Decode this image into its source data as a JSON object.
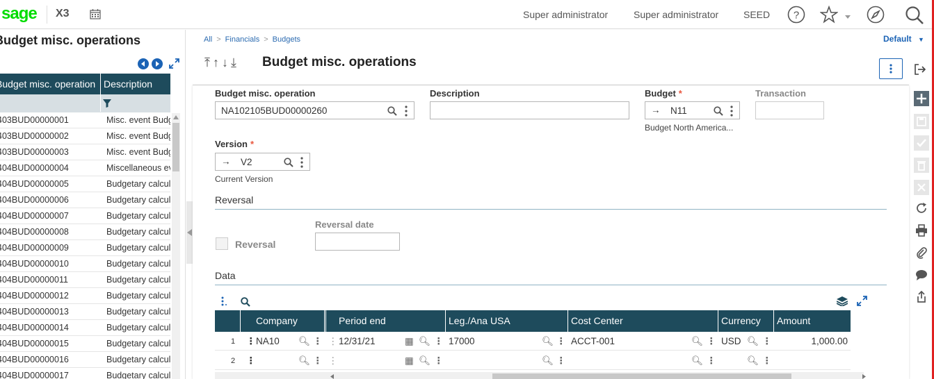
{
  "app": {
    "logo": "sage",
    "product": "X3"
  },
  "header": {
    "user1": "Super administrator",
    "user2": "Super administrator",
    "folder": "SEED"
  },
  "left_panel": {
    "title": "Budget misc. operations",
    "col1": "Budget misc. operation",
    "col2": "Description",
    "rows": [
      {
        "code": "403BUD00000001",
        "desc": "Misc. event Budget"
      },
      {
        "code": "403BUD00000002",
        "desc": "Misc. event Budget"
      },
      {
        "code": "403BUD00000003",
        "desc": "Misc. event Budget"
      },
      {
        "code": "404BUD00000004",
        "desc": "Miscellaneous event"
      },
      {
        "code": "404BUD00000005",
        "desc": "Budgetary calculation"
      },
      {
        "code": "404BUD00000006",
        "desc": "Budgetary calculation"
      },
      {
        "code": "404BUD00000007",
        "desc": "Budgetary calculation"
      },
      {
        "code": "404BUD00000008",
        "desc": "Budgetary calculation"
      },
      {
        "code": "404BUD00000009",
        "desc": "Budgetary calculation"
      },
      {
        "code": "404BUD00000010",
        "desc": "Budgetary calculation"
      },
      {
        "code": "404BUD00000011",
        "desc": "Budgetary calculation"
      },
      {
        "code": "404BUD00000012",
        "desc": "Budgetary calculation"
      },
      {
        "code": "404BUD00000013",
        "desc": "Budgetary calculation"
      },
      {
        "code": "404BUD00000014",
        "desc": "Budgetary calculation"
      },
      {
        "code": "404BUD00000015",
        "desc": "Budgetary calculation"
      },
      {
        "code": "404BUD00000016",
        "desc": "Budgetary calculation"
      },
      {
        "code": "404BUD00000017",
        "desc": "Budgetary calculation"
      }
    ]
  },
  "breadcrumb": [
    "All",
    "Financials",
    "Budgets"
  ],
  "default_label": "Default",
  "page_title": "Budget misc. operations",
  "form": {
    "op_label": "Budget misc. operation",
    "op_value": "NA102105BUD00000260",
    "desc_label": "Description",
    "desc_value": "",
    "budget_label": "Budget",
    "budget_value": "N11",
    "budget_sub": "Budget North America...",
    "transaction_label": "Transaction",
    "transaction_value": "",
    "version_label": "Version",
    "version_value": "V2",
    "version_sub": "Current Version",
    "reversal_section": "Reversal",
    "reversal_label": "Reversal",
    "reversal_checked": false,
    "reversal_date_label": "Reversal date",
    "reversal_date_value": "",
    "data_section": "Data"
  },
  "grid": {
    "columns": [
      "Company",
      "Period end",
      "Leg./Ana USA",
      "Cost Center",
      "Currency",
      "Amount"
    ],
    "rows": [
      {
        "num": "1",
        "company": "NA10",
        "period_end": "12/31/21",
        "leg": "17000",
        "cost_center": "ACCT-001",
        "currency": "USD",
        "amount": "1,000.00"
      },
      {
        "num": "2",
        "company": "",
        "period_end": "",
        "leg": "",
        "cost_center": "",
        "currency": "",
        "amount": ""
      }
    ]
  },
  "colors": {
    "brand": "#00dc00",
    "header_bg": "#1e4b5c",
    "accent": "#1b63b5",
    "required": "#e9573e"
  }
}
